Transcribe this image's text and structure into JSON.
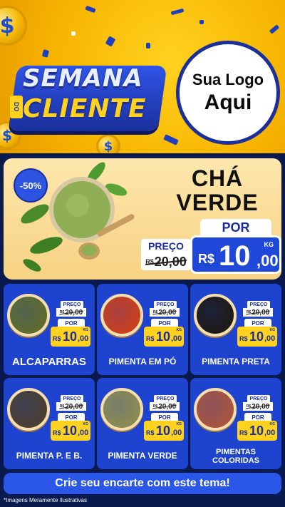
{
  "header": {
    "title_line1": "SEMANA",
    "title_small": "DO",
    "title_line2": "CLIENTE",
    "logo_line1": "Sua Logo",
    "logo_line2": "Aqui",
    "coin_symbol": "$"
  },
  "featured": {
    "discount": "-50%",
    "title_line1": "CHÁ",
    "title_line2": "VERDE",
    "preco_label": "PREÇO",
    "old_currency": "R$",
    "old_value": "20,00",
    "por_label": "POR",
    "new_currency": "R$",
    "new_int": "10",
    "new_dec": ",00",
    "unit": "KG"
  },
  "products": [
    {
      "name": "ALCAPARRAS",
      "preco_label": "PREÇO",
      "old_currency": "R$",
      "old_value": "20,00",
      "por_label": "POR",
      "new_currency": "R$",
      "new_int": "10",
      "new_dec": ",00",
      "unit": "KG",
      "color": "#5f6b2f"
    },
    {
      "name": "PIMENTA EM PÓ",
      "preco_label": "PREÇO",
      "old_currency": "R$",
      "old_value": "20,00",
      "por_label": "POR",
      "new_currency": "R$",
      "new_int": "10",
      "new_dec": ",00",
      "unit": "KG",
      "color": "#c9401e"
    },
    {
      "name": "PIMENTA PRETA",
      "preco_label": "PREÇO",
      "old_currency": "R$",
      "old_value": "20,00",
      "por_label": "POR",
      "new_currency": "R$",
      "new_int": "10",
      "new_dec": ",00",
      "unit": "KG",
      "color": "#1e1a16"
    },
    {
      "name": "PIMENTA P. E B.",
      "preco_label": "PREÇO",
      "old_currency": "R$",
      "old_value": "20,00",
      "por_label": "POR",
      "new_currency": "R$",
      "new_int": "10",
      "new_dec": ",00",
      "unit": "KG",
      "color": "#4a3f33"
    },
    {
      "name": "PIMENTA VERDE",
      "preco_label": "PREÇO",
      "old_currency": "R$",
      "old_value": "20,00",
      "por_label": "POR",
      "new_currency": "R$",
      "new_int": "10",
      "new_dec": ",00",
      "unit": "KG",
      "color": "#8b8b52"
    },
    {
      "name_line1": "PIMENTAS",
      "name_line2": "COLORIDAS",
      "preco_label": "PREÇO",
      "old_currency": "R$",
      "old_value": "20,00",
      "por_label": "POR",
      "new_currency": "R$",
      "new_int": "10",
      "new_dec": ",00",
      "unit": "KG",
      "color": "#a8553f"
    }
  ],
  "footer": {
    "cta": "Crie seu encarte com este tema!",
    "disclaimer": "*Imagens Meramente Ilustrativas"
  },
  "colors": {
    "brand_blue": "#1e44cf",
    "accent_yellow": "#ffd21f",
    "background": "#0a1a4d"
  }
}
